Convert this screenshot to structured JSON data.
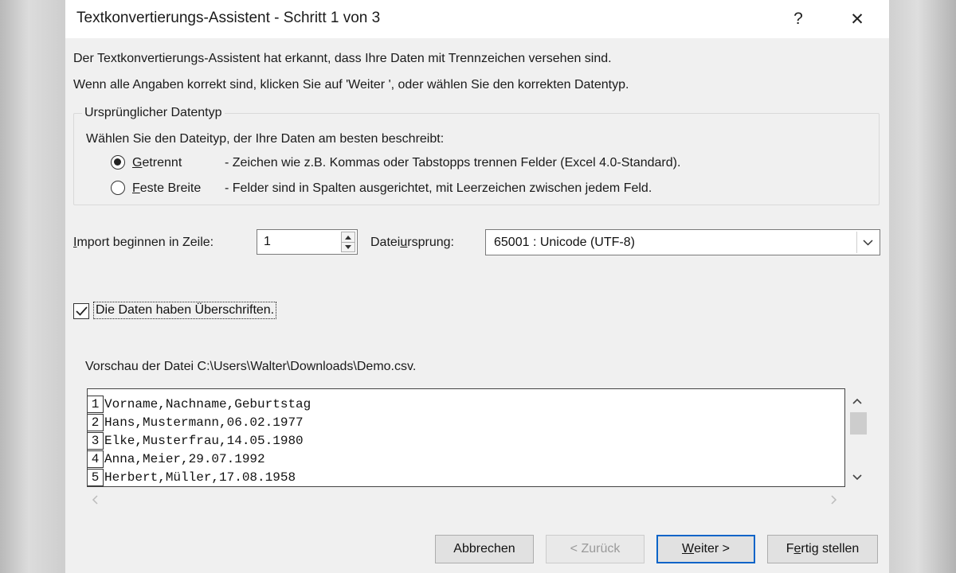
{
  "window": {
    "title": "Textkonvertierungs-Assistent - Schritt 1 von 3",
    "help_glyph": "?",
    "close_glyph": "✕"
  },
  "intro": {
    "line1": "Der Textkonvertierungs-Assistent hat erkannt, dass Ihre Daten mit Trennzeichen versehen sind.",
    "line2": "Wenn alle Angaben korrekt sind, klicken Sie auf 'Weiter ', oder wählen Sie den korrekten Datentyp."
  },
  "datatype_group": {
    "legend": "Ursprünglicher Datentyp",
    "prompt": "Wählen Sie den Dateityp, der Ihre Daten am besten beschreibt:",
    "options": [
      {
        "mnemonic": "G",
        "label_rest": "etrennt",
        "description": "- Zeichen wie z.B. Kommas oder Tabstopps trennen Felder (Excel 4.0-Standard).",
        "selected": true
      },
      {
        "mnemonic": "F",
        "label_rest": "este Breite",
        "description": "- Felder sind in Spalten ausgerichtet, mit Leerzeichen zwischen jedem Feld.",
        "selected": false
      }
    ]
  },
  "import_row": {
    "label_mnemonic": "I",
    "label_rest": "mport beginnen in Zeile:",
    "value": "1"
  },
  "origin": {
    "label_pre": "Datei",
    "label_mnemonic": "u",
    "label_post": "rsprung:",
    "value": "65001 : Unicode (UTF-8)"
  },
  "headers_checkbox": {
    "label": "Die Daten haben Überschriften.",
    "checked": true
  },
  "preview": {
    "label": "Vorschau der Datei C:\\Users\\Walter\\Downloads\\Demo.csv.",
    "rows": [
      {
        "num": "1",
        "text": "Vorname,Nachname,Geburtstag"
      },
      {
        "num": "2",
        "text": "Hans,Mustermann,06.02.1977"
      },
      {
        "num": "3",
        "text": "Elke,Musterfrau,14.05.1980"
      },
      {
        "num": "4",
        "text": "Anna,Meier,29.07.1992"
      },
      {
        "num": "5",
        "text": "Herbert,Müller,17.08.1958"
      }
    ]
  },
  "buttons": {
    "cancel": "Abbrechen",
    "back": "< Zurück",
    "next_mnemonic": "W",
    "next_rest": "eiter >",
    "finish_pre": "F",
    "finish_mnemonic": "e",
    "finish_post": "rtig stellen"
  },
  "icons": {
    "radio": "radio-button",
    "check": "checkmark-icon",
    "chevron": "chevron-down-icon"
  }
}
